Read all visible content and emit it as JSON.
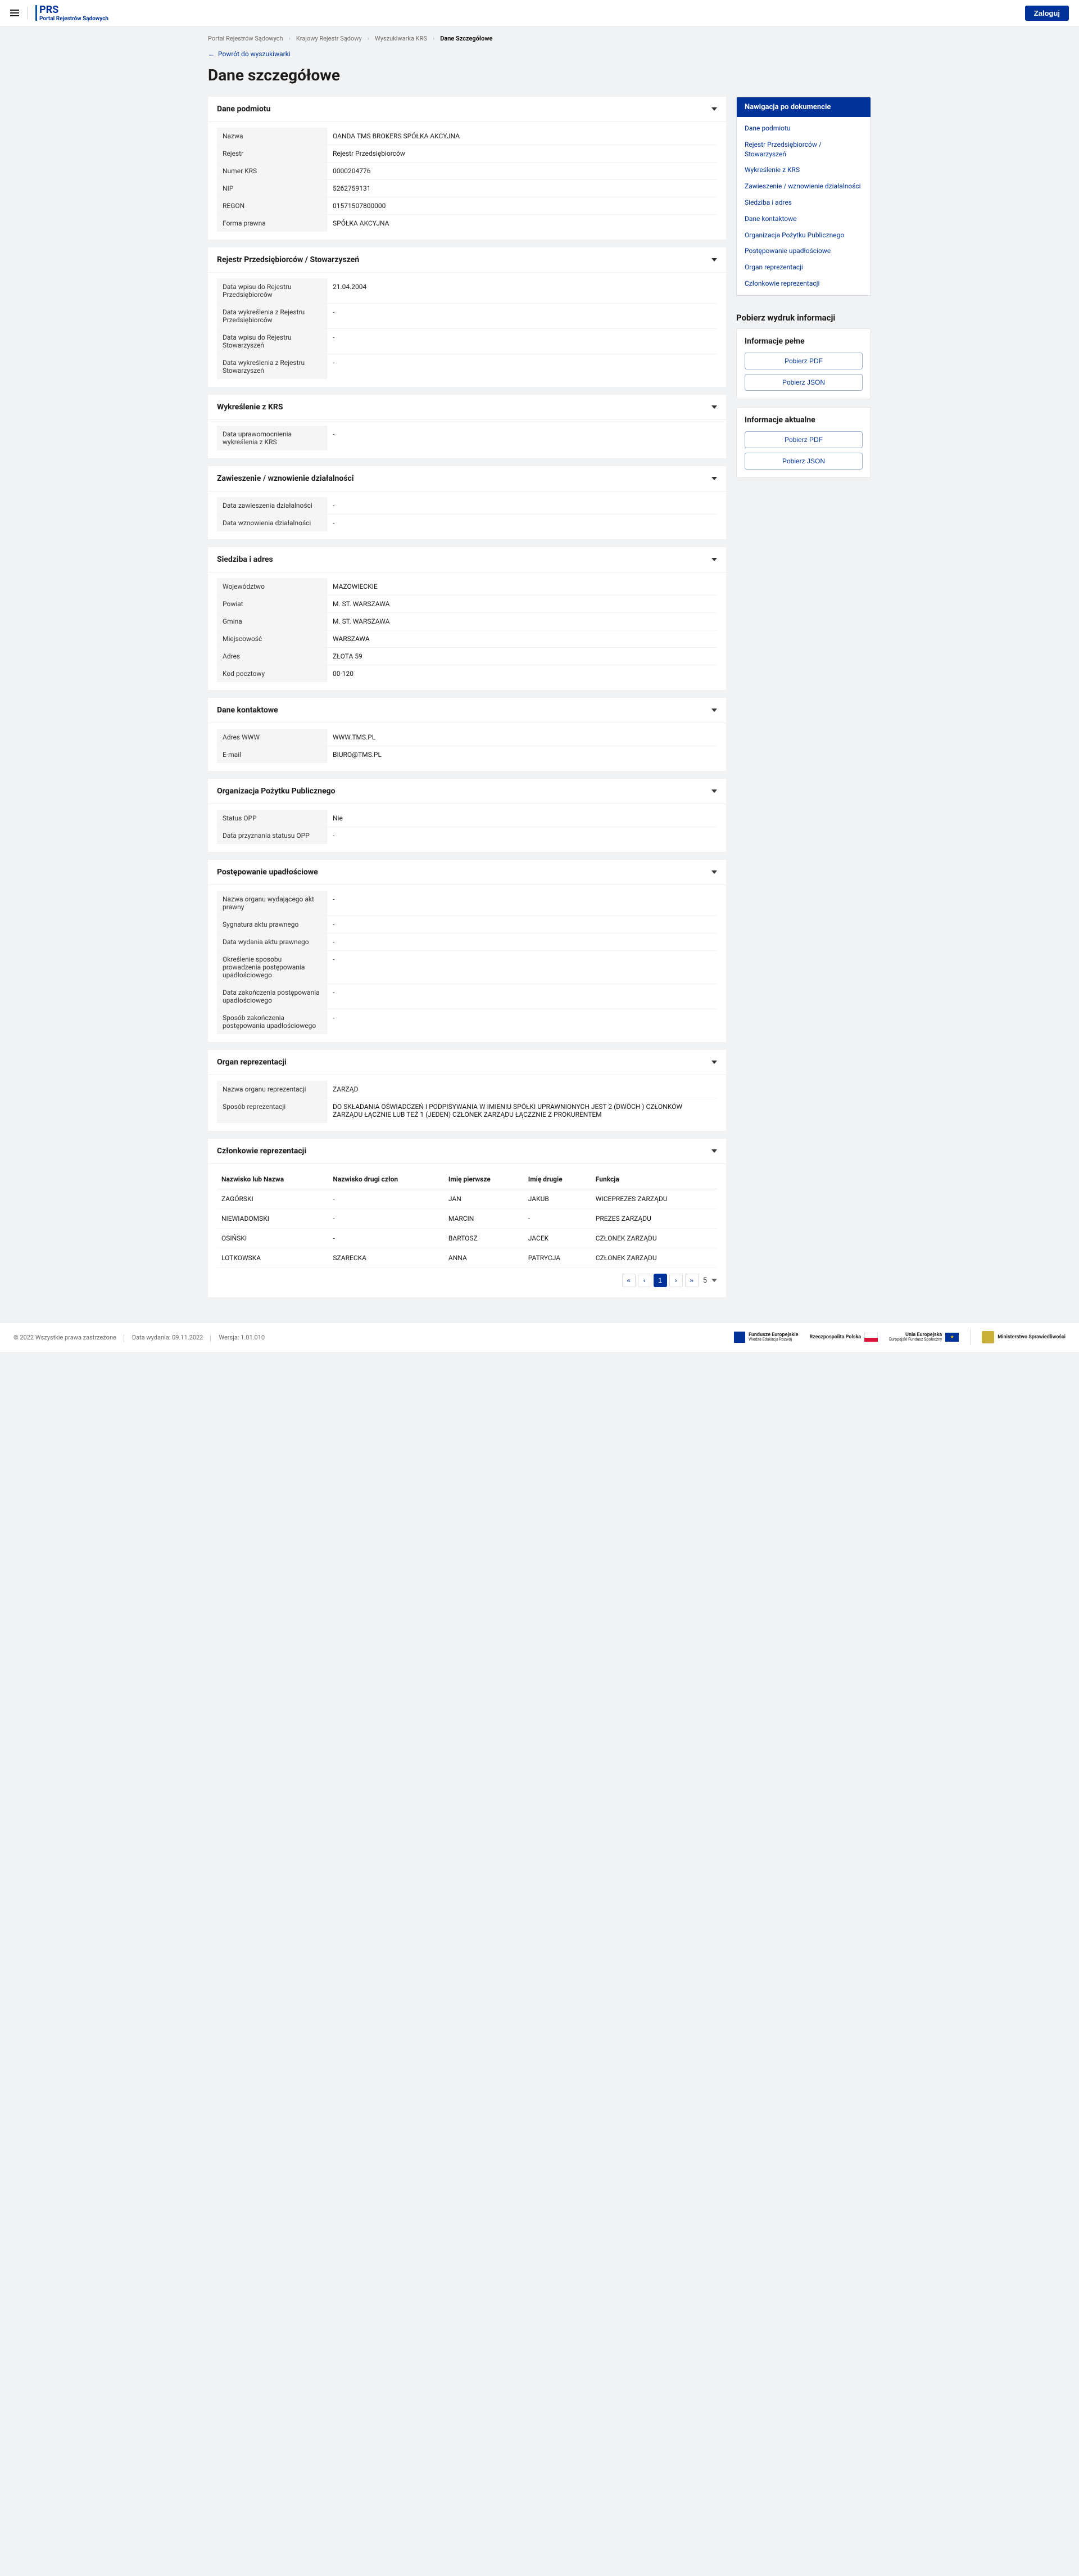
{
  "header": {
    "logo_abbr": "PRS",
    "logo_full": "Portal Rejestrów Sądowych",
    "login": "Zaloguj"
  },
  "breadcrumbs": [
    "Portal Rejestrów Sądowych",
    "Krajowy Rejestr Sądowy",
    "Wyszukiwarka KRS",
    "Dane Szczegółowe"
  ],
  "return_link": "Powrót do wyszukiwarki",
  "page_title": "Dane szczegółowe",
  "nav": {
    "title": "Nawigacja po dokumencie",
    "items": [
      "Dane podmiotu",
      "Rejestr Przedsiębiorców / Stowarzyszeń",
      "Wykreślenie z KRS",
      "Zawieszenie / wznowienie działalności",
      "Siedziba i adres",
      "Dane kontaktowe",
      "Organizacja Pożytku Publicznego",
      "Postępowanie upadłościowe",
      "Organ reprezentacji",
      "Członkowie reprezentacji"
    ]
  },
  "downloads": {
    "section_title": "Pobierz wydruk informacji",
    "full_title": "Informacje pełne",
    "current_title": "Informacje aktualne",
    "pdf": "Pobierz PDF",
    "json": "Pobierz JSON"
  },
  "sections": {
    "podmiot": {
      "title": "Dane podmiotu",
      "rows": [
        {
          "l": "Nazwa",
          "v": "OANDA TMS BROKERS SPÓŁKA AKCYJNA"
        },
        {
          "l": "Rejestr",
          "v": "Rejestr Przedsiębiorców"
        },
        {
          "l": "Numer KRS",
          "v": "0000204776"
        },
        {
          "l": "NIP",
          "v": "5262759131"
        },
        {
          "l": "REGON",
          "v": "01571507800000"
        },
        {
          "l": "Forma prawna",
          "v": "SPÓŁKA AKCYJNA"
        }
      ]
    },
    "rejestr": {
      "title": "Rejestr Przedsiębiorców / Stowarzyszeń",
      "rows": [
        {
          "l": "Data wpisu do Rejestru Przedsiębiorców",
          "v": "21.04.2004"
        },
        {
          "l": "Data wykreślenia z Rejestru Przedsiębiorców",
          "v": "-"
        },
        {
          "l": "Data wpisu do Rejestru Stowarzyszeń",
          "v": "-"
        },
        {
          "l": "Data wykreślenia z Rejestru Stowarzyszeń",
          "v": "-"
        }
      ]
    },
    "wykreslenie": {
      "title": "Wykreślenie z KRS",
      "rows": [
        {
          "l": "Data uprawomocnienia wykreślenia z KRS",
          "v": "-"
        }
      ]
    },
    "zawieszenie": {
      "title": "Zawieszenie / wznowienie działalności",
      "rows": [
        {
          "l": "Data zawieszenia działalności",
          "v": "-"
        },
        {
          "l": "Data wznowienia działalności",
          "v": "-"
        }
      ]
    },
    "siedziba": {
      "title": "Siedziba i adres",
      "rows": [
        {
          "l": "Województwo",
          "v": "MAZOWIECKIE"
        },
        {
          "l": "Powiat",
          "v": "M. ST. WARSZAWA"
        },
        {
          "l": "Gmina",
          "v": "M. ST. WARSZAWA"
        },
        {
          "l": "Miejscowość",
          "v": "WARSZAWA"
        },
        {
          "l": "Adres",
          "v": "ZŁOTA 59"
        },
        {
          "l": "Kod pocztowy",
          "v": "00-120"
        }
      ]
    },
    "kontakt": {
      "title": "Dane kontaktowe",
      "rows": [
        {
          "l": "Adres WWW",
          "v": "WWW.TMS.PL"
        },
        {
          "l": "E-mail",
          "v": "BIURO@TMS.PL"
        }
      ]
    },
    "opp": {
      "title": "Organizacja Pożytku Publicznego",
      "rows": [
        {
          "l": "Status OPP",
          "v": "Nie"
        },
        {
          "l": "Data przyznania statusu OPP",
          "v": "-"
        }
      ]
    },
    "upadlosc": {
      "title": "Postępowanie upadłościowe",
      "rows": [
        {
          "l": "Nazwa organu wydającego akt prawny",
          "v": "-"
        },
        {
          "l": "Sygnatura aktu prawnego",
          "v": "-"
        },
        {
          "l": "Data wydania aktu prawnego",
          "v": "-"
        },
        {
          "l": "Określenie sposobu prowadzenia postępowania upadłościowego",
          "v": "-"
        },
        {
          "l": "Data zakończenia postępowania upadłościowego",
          "v": "-"
        },
        {
          "l": "Sposób zakończenia postępowania upadłościowego",
          "v": "-"
        }
      ]
    },
    "organ": {
      "title": "Organ reprezentacji",
      "rows": [
        {
          "l": "Nazwa organu reprezentacji",
          "v": "ZARZĄD"
        },
        {
          "l": "Sposób reprezentacji",
          "v": "DO SKŁADANIA OŚWIADCZEŃ I PODPISYWANIA W IMIENIU SPÓŁKI UPRAWNIONYCH JEST 2 (DWÓCH ) CZŁONKÓW ZARZĄDU ŁĄCZNIE LUB TEŻ 1 (JEDEN) CZŁONEK ZARZĄDU ŁĄCZZNIE Z PROKURENTEM"
        }
      ]
    },
    "czlonkowie": {
      "title": "Członkowie reprezentacji",
      "headers": [
        "Nazwisko lub Nazwa",
        "Nazwisko drugi człon",
        "Imię pierwsze",
        "Imię drugie",
        "Funkcja"
      ],
      "rows": [
        [
          "ZAGÓRSKI",
          "-",
          "JAN",
          "JAKUB",
          "WICEPREZES ZARZĄDU"
        ],
        [
          "NIEWIADOMSKI",
          "-",
          "MARCIN",
          "-",
          "PREZES ZARZĄDU"
        ],
        [
          "OSIŃSKI",
          "-",
          "BARTOSZ",
          "JACEK",
          "CZŁONEK ZARZĄDU"
        ],
        [
          "LOTKOWSKA",
          "SZARECKA",
          "ANNA",
          "PATRYCJA",
          "CZŁONEK ZARZĄDU"
        ]
      ],
      "page_count": "5"
    }
  },
  "footer": {
    "copyright": "© 2022 Wszystkie prawa zastrzeżone",
    "release": "Data wydania: 09.11.2022",
    "version": "Wersja: 1.01.010",
    "logos": {
      "fe": "Fundusze Europejskie",
      "fe_sub": "Wiedza Edukacja Rozwój",
      "rp": "Rzeczpospolita Polska",
      "ue": "Unia Europejska",
      "ue_sub": "Europejski Fundusz Społeczny",
      "ms": "Ministerstwo Sprawiedliwości"
    }
  }
}
